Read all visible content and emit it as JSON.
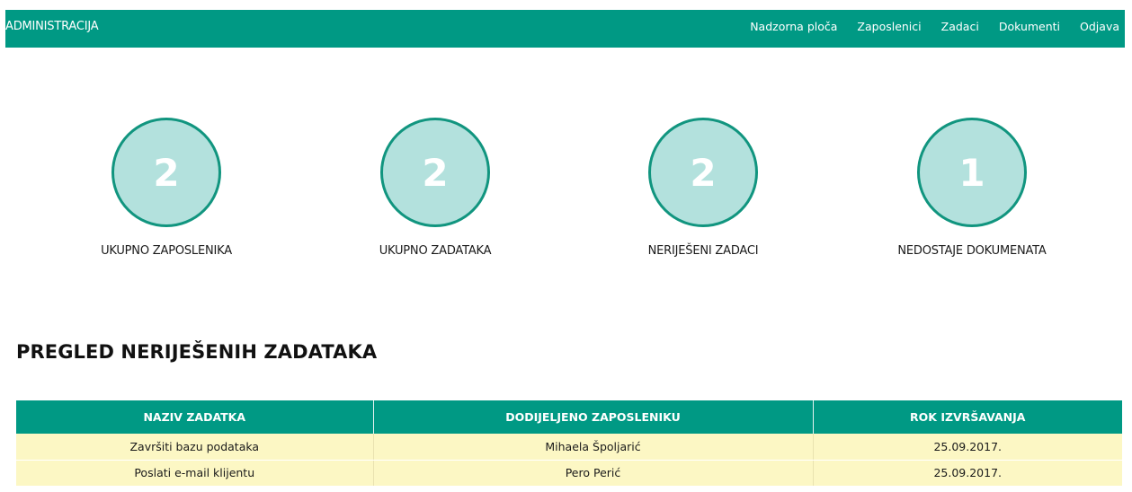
{
  "header": {
    "brand": "ADMINISTRACIJA",
    "nav": [
      "Nadzorna ploča",
      "Zaposlenici",
      "Zadaci",
      "Dokumenti",
      "Odjava"
    ]
  },
  "stats": [
    {
      "value": "2",
      "label": "UKUPNO ZAPOSLENIKA"
    },
    {
      "value": "2",
      "label": "UKUPNO ZADATAKA"
    },
    {
      "value": "2",
      "label": "NERIJEŠENI ZADACI"
    },
    {
      "value": "1",
      "label": "NEDOSTAJE DOKUMENATA"
    }
  ],
  "section": {
    "title": "PREGLED NERIJEŠENIH ZADATAKA"
  },
  "table": {
    "headers": [
      "NAZIV ZADATKA",
      "DODIJELJENO ZAPOSLENIKU",
      "ROK IZVRŠAVANJA"
    ],
    "rows": [
      [
        "Završiti bazu podataka",
        "Mihaela Špoljarić",
        "25.09.2017."
      ],
      [
        "Poslati e-mail klijentu",
        "Pero Perić",
        "25.09.2017."
      ]
    ]
  },
  "colors": {
    "accent": "#009984",
    "circle_fill": "#b3e1dd",
    "row_bg": "#fcf7c4"
  }
}
